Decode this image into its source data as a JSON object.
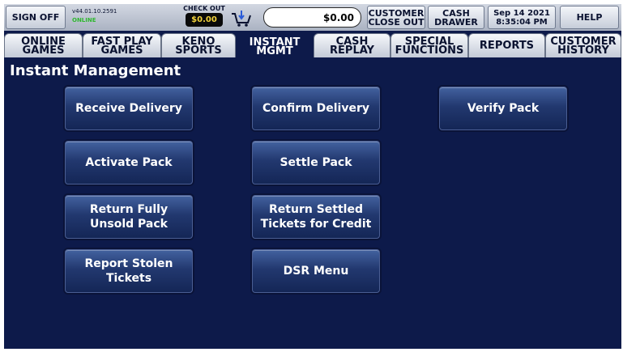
{
  "topbar": {
    "sign_off": "SIGN OFF",
    "version": "v44.01.10.2591",
    "connection": "ONLINE",
    "checkout_label": "CHECK OUT",
    "checkout_amount": "$0.00",
    "amount_display": "$0.00",
    "customer_closeout": "CUSTOMER\nCLOSE OUT",
    "cash_drawer": "CASH\nDRAWER",
    "datetime": "Sep 14 2021\n8:35:04 PM",
    "help": "HELP"
  },
  "tabs": [
    {
      "label": "ONLINE\nGAMES"
    },
    {
      "label": "FAST PLAY\nGAMES"
    },
    {
      "label": "KENO\nSPORTS"
    },
    {
      "label": "INSTANT\nMGMT",
      "active": true
    },
    {
      "label": "CASH\nREPLAY"
    },
    {
      "label": "SPECIAL\nFUNCTIONS"
    },
    {
      "label": "REPORTS"
    },
    {
      "label": "CUSTOMER\nHISTORY"
    }
  ],
  "page_title": "Instant Management",
  "buttons": {
    "receive_delivery": "Receive Delivery",
    "confirm_delivery": "Confirm Delivery",
    "verify_pack": "Verify Pack",
    "activate_pack": "Activate Pack",
    "settle_pack": "Settle Pack",
    "return_unsold": "Return Fully\nUnsold Pack",
    "return_settled": "Return Settled\nTickets for Credit",
    "report_stolen": "Report Stolen\nTickets",
    "dsr_menu": "DSR Menu"
  },
  "colors": {
    "background": "#0d1a4a",
    "button_top": "#43629f",
    "button_bottom": "#142656",
    "online": "#2fb82f",
    "checkout_amount": "#f2d23c"
  }
}
